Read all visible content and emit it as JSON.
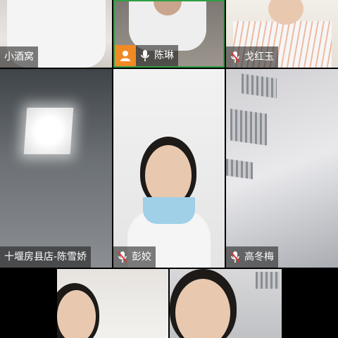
{
  "participants": [
    {
      "name": "小酒窝",
      "mic_icon": "none",
      "host": false
    },
    {
      "name": "陈琳",
      "mic_icon": "microphone-icon",
      "host": true
    },
    {
      "name": "戈红玉",
      "mic_icon": "microphone-muted-icon",
      "host": false
    },
    {
      "name": "十堰房县店-陈雪娇",
      "mic_icon": "none",
      "host": false
    },
    {
      "name": "彭姣",
      "mic_icon": "microphone-muted-icon",
      "host": false
    },
    {
      "name": "高冬梅",
      "mic_icon": "microphone-muted-icon",
      "host": false
    }
  ],
  "colors": {
    "active_speaker_border": "#2f9e44",
    "host_badge": "#f08a24",
    "muted_mic": "#e03131"
  }
}
